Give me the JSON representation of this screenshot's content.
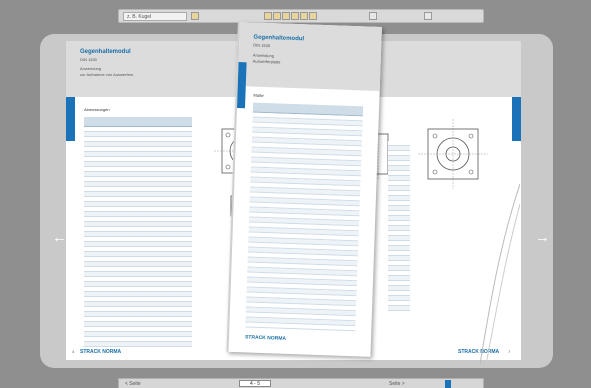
{
  "toolbar": {
    "search_value": "z. B. Kugel",
    "icons": [
      "print-icon",
      "save-icon",
      "email-icon",
      "bookmark-icon",
      "zoom-icon",
      "close-icon"
    ]
  },
  "book": {
    "left_page": {
      "title": "Gegenhaltemodul",
      "subtitle": "DIN 1530",
      "desc1": "Anwendung",
      "desc2": "zur Aufnahme von Auswerfern",
      "section": "Abmessungen",
      "footer_logo": "STRACK NORMA",
      "page_number": "4"
    },
    "right_page": {
      "title": "",
      "footer_logo": "STRACK NORMA",
      "page_number": "7"
    },
    "flipping_page": {
      "title": "Gegenhaltemodul",
      "subtitle": "DIN 1530",
      "desc1": "Anwendung",
      "desc2": "Auswerferplatte",
      "section": "Maße",
      "footer_logo": "STRACK NORMA"
    }
  },
  "bottombar": {
    "page_field": "4 - 5",
    "prev_label": "< Seite",
    "next_label": "Seite >"
  }
}
